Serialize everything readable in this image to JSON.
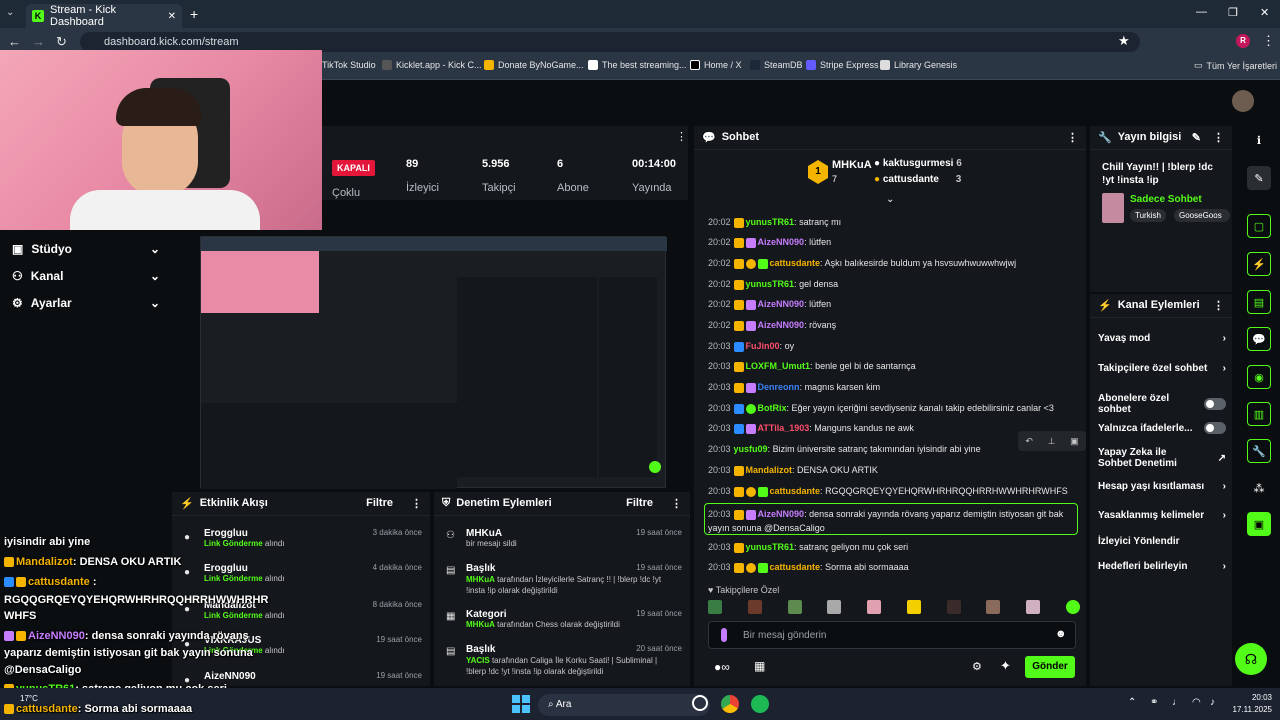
{
  "browser": {
    "tab_title": "Stream - Kick Dashboard",
    "url": "dashboard.kick.com/stream",
    "bookmarks": [
      "TikTok Studio",
      "Kicklet.app - Kick C...",
      "Donate ByNoGame...",
      "The best streaming...",
      "Home / X",
      "SteamDB",
      "Stripe Express",
      "Library Genesis"
    ],
    "bookmarks_right": "Tüm Yer İşaretleri",
    "profile_initial": "R"
  },
  "stats": {
    "status": "KAPALI",
    "status_label": "Çoklu",
    "items": [
      {
        "value": "89",
        "label": "İzleyici"
      },
      {
        "value": "5.956",
        "label": "Takipçi"
      },
      {
        "value": "6",
        "label": "Abone"
      },
      {
        "value": "00:14:00",
        "label": "Yayında"
      }
    ]
  },
  "nav": [
    "Stüdyo",
    "Kanal",
    "Ayarlar"
  ],
  "events": {
    "title": "Etkinlik Akışı",
    "filter": "Filtre",
    "items": [
      {
        "name": "Eroggluu",
        "action": "Link Gönderme",
        "suffix": "alındı",
        "time": "3 dakika önce"
      },
      {
        "name": "Eroggluu",
        "action": "Link Gönderme",
        "suffix": "alındı",
        "time": "4 dakika önce"
      },
      {
        "name": "Mandalizot",
        "action": "Link Gönderme",
        "suffix": "alındı",
        "time": "8 dakika önce"
      },
      {
        "name": "VIXKRA3US",
        "action": "Link Gönderme",
        "suffix": "alındı",
        "time": "19 saat önce"
      },
      {
        "name": "AizeNN090",
        "action": "",
        "suffix": "",
        "time": "19 saat önce"
      }
    ]
  },
  "moderation": {
    "title": "Denetim Eylemleri",
    "filter": "Filtre",
    "items": [
      {
        "title": "MHKuA",
        "desc_user": "",
        "desc": "bir mesajı sildi",
        "time": "19 saat önce"
      },
      {
        "title": "Başlık",
        "desc_user": "MHKuA",
        "desc": "tarafından İzleyicilerle Satranç !! | !blerp !dc !yt !insta !ip olarak değiştirildi",
        "time": "19 saat önce"
      },
      {
        "title": "Kategori",
        "desc_user": "MHKuA",
        "desc": "tarafından Chess olarak değiştirildi",
        "time": "19 saat önce"
      },
      {
        "title": "Başlık",
        "desc_user": "YACIS",
        "desc": "tarafından Caliga İle Korku Saati! | Subliminal | !blerp !dc !yt !insta !ip olarak değiştirildi",
        "time": "20 saat önce"
      }
    ]
  },
  "chat": {
    "title": "Sohbet",
    "top_user": "MHKuA",
    "top_rank": "1",
    "top_count": "7",
    "leaders": [
      {
        "name": "kaktusgurmesi",
        "count": "6"
      },
      {
        "name": "cattusdante",
        "count": "3"
      }
    ],
    "messages": [
      {
        "time": "20:02",
        "user": "yunusTR61",
        "color": "#53fc18",
        "text": "satranç mı"
      },
      {
        "time": "20:02",
        "user": "AizeNN090",
        "color": "#c77dff",
        "text": "lütfen"
      },
      {
        "time": "20:02",
        "user": "cattusdante",
        "color": "#f5b400",
        "text": "Aşkı balıkesirde buldum ya hsvsuwhwuwwhwjwj"
      },
      {
        "time": "20:02",
        "user": "yunusTR61",
        "color": "#53fc18",
        "text": "gel densa"
      },
      {
        "time": "20:02",
        "user": "AizeNN090",
        "color": "#c77dff",
        "text": "lütfen"
      },
      {
        "time": "20:02",
        "user": "AizeNN090",
        "color": "#c77dff",
        "text": "rövanş"
      },
      {
        "time": "20:03",
        "user": "FuJin00",
        "color": "#ff4d6d",
        "text": "oy"
      },
      {
        "time": "20:03",
        "user": "LOXFM_Umut1",
        "color": "#53fc18",
        "text": "benle gel bi de santarnça"
      },
      {
        "time": "20:03",
        "user": "Denreonn",
        "color": "#3b82f6",
        "text": "magnıs karsen kim"
      },
      {
        "time": "20:03",
        "user": "BotRix",
        "color": "#53fc18",
        "text": "Eğer yayın içeriğini sevdiyseniz kanalı takip edebilirsiniz canlar <3"
      },
      {
        "time": "20:03",
        "user": "ATTila_1903",
        "color": "#ff4d6d",
        "text": "Manguns kandus ne awk"
      },
      {
        "time": "20:03",
        "user": "yusfu09",
        "color": "#53fc18",
        "text": "Bizim üniversite satranç takımından iyisindir abi yine"
      },
      {
        "time": "20:03",
        "user": "Mandalizot",
        "color": "#f5b400",
        "text": "DENSA OKU ARTIK"
      },
      {
        "time": "20:03",
        "user": "cattusdante",
        "color": "#f5b400",
        "text": "RGQQGRQEYQYEHQRWHRHRQQHRRHWWHRHRWHFS"
      },
      {
        "time": "20:03",
        "user": "AizeNN090",
        "color": "#c77dff",
        "text": "densa sonraki yayında rövanş yaparız demiştin istiyosan git bak yayın sonuna @DensaCaligo"
      },
      {
        "time": "20:03",
        "user": "yunusTR61",
        "color": "#53fc18",
        "text": "satranç geliyon mu çok seri"
      },
      {
        "time": "20:03",
        "user": "cattusdante",
        "color": "#f5b400",
        "text": "Sorma abi sormaaaa"
      }
    ],
    "emote_label": "Takipçilere Özel",
    "input_placeholder": "Bir mesaj gönderin",
    "send": "Gönder"
  },
  "stream_info": {
    "title": "Yayın bilgisi",
    "stream_title": "Chill Yayın!! | !blerp !dc !yt !insta !ip",
    "category": "Sadece Sohbet",
    "tags": [
      "Turkish",
      "GooseGoos"
    ]
  },
  "channel_actions": {
    "title": "Kanal Eylemleri",
    "items": [
      "Yavaş mod",
      "Takipçilere özel sohbet",
      "Abonelere özel sohbet",
      "Yalnızca ifadelerle...",
      "Yapay Zeka ile Sohbet Denetimi",
      "Hesap yaşı kısıtlaması",
      "Yasaklanmış kelimeler",
      "İzleyici Yönlendir",
      "Hedefleri belirleyin"
    ]
  },
  "overlay": {
    "lines": [
      {
        "user": "",
        "text": "iyisindir abi yine"
      },
      {
        "user": "Mandalizot",
        "text": ": DENSA OKU ARTIK"
      },
      {
        "user": "cattusdante",
        "text": ":"
      },
      {
        "user": "",
        "text": "RGQQGRQEYQYEHQRWHRHRQQHRRHWWHRHR"
      },
      {
        "user": "",
        "text": "WHFS"
      },
      {
        "user": "AizeNN090",
        "text": ": densa sonraki yayında rövanş"
      },
      {
        "user": "",
        "text": "yaparız demiştin istiyosan git bak yayın sonuna"
      },
      {
        "user": "",
        "text": "@DensaCaligo"
      },
      {
        "user": "yunusTR61",
        "text": ": satranç geliyon mu çok seri"
      },
      {
        "user": "cattusdante",
        "text": ": Sorma abi sormaaaa"
      }
    ]
  },
  "taskbar": {
    "search": "Ara",
    "weather": "17°C",
    "time": "20:03",
    "date": "17.11.2025"
  }
}
